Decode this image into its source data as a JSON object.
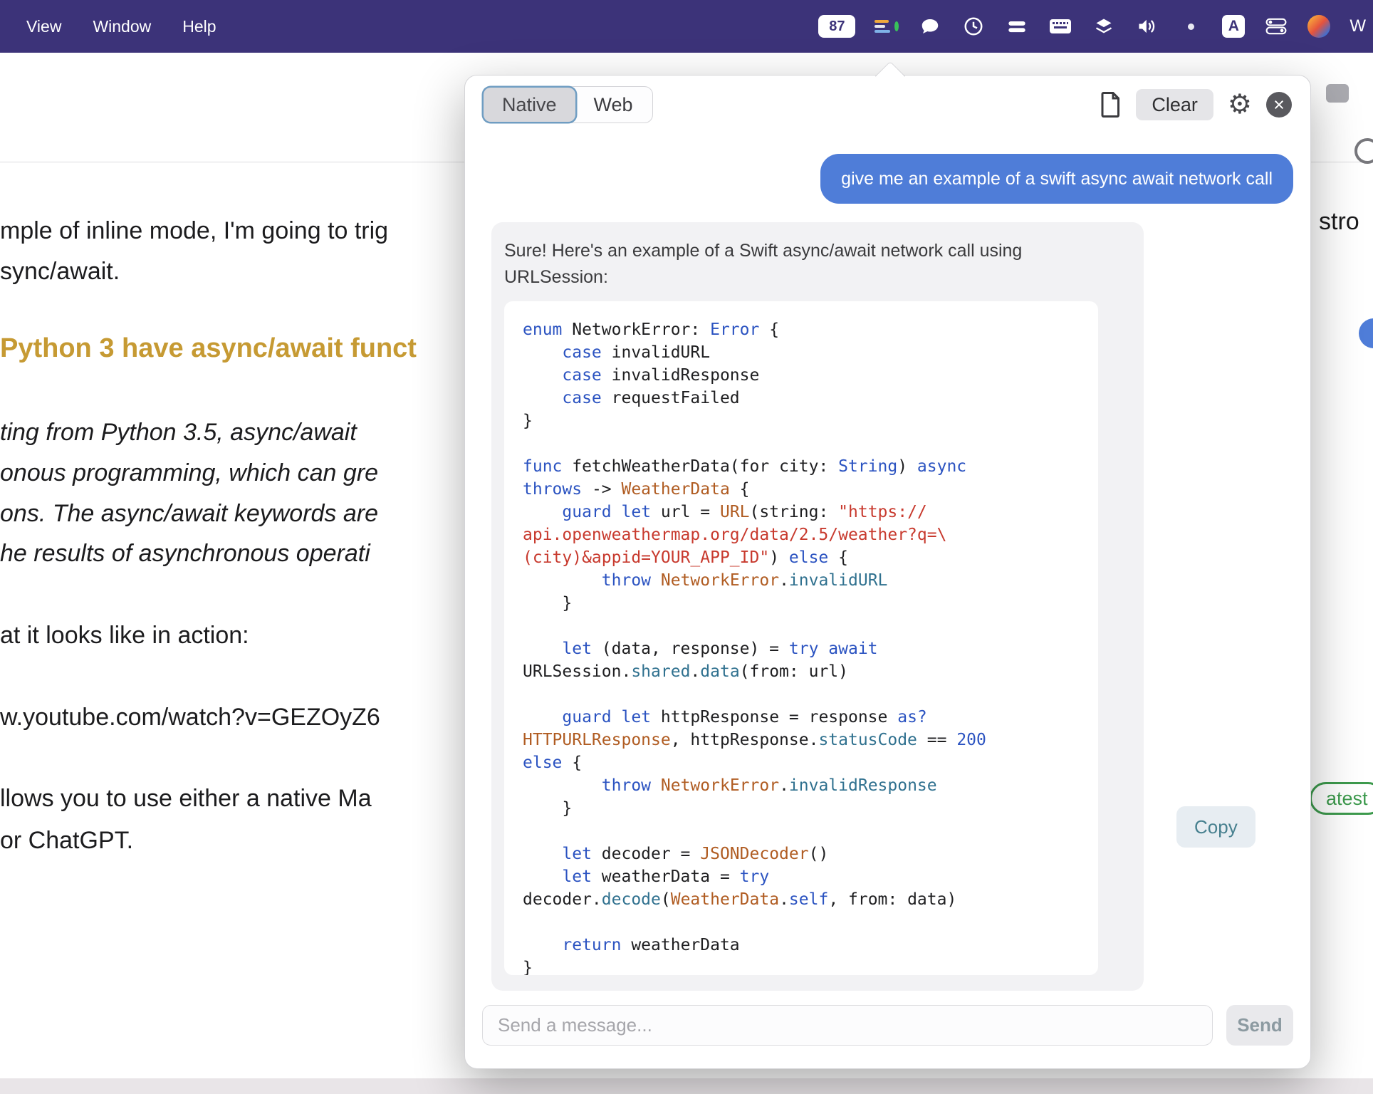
{
  "theme": {
    "menubar_bg": "#3c3379",
    "accent_bubble": "#4f7dd8",
    "heading": "#c69a33",
    "badge_green": "#3d9a4d"
  },
  "menubar": {
    "items": [
      {
        "label": "View"
      },
      {
        "label": "Window"
      },
      {
        "label": "Help"
      }
    ],
    "battery_percent": "87",
    "right_edge_label": "W",
    "icon_names": [
      "istat-bars-icon",
      "chat-bubble-icon",
      "clock-icon",
      "stacked-bars-icon",
      "keyboard-icon",
      "layers-icon",
      "volume-icon",
      "recording-dot-icon",
      "input-source-a-icon",
      "control-center-icon",
      "profile-avatar-icon"
    ]
  },
  "toolbar": {
    "icon_names": [
      "chevron-up-icon",
      "chevron-down-icon",
      "back-icon",
      "plus-icon",
      "microphone-icon",
      "import-tray-icon",
      "trash-icon",
      "clock-icon",
      "person-icon",
      "shield-icon",
      "chevron-up-small-icon",
      "window-icon"
    ]
  },
  "background_page": {
    "para_line_1": "mple of inline mode, I'm going to trig",
    "para_line_2": "sync/await.",
    "heading": "Python 3 have async/await funct",
    "italic_lines": [
      "ting from Python 3.5, async/await",
      "onous programming, which can gre",
      "ons. The async/await keywords are",
      "he results of asynchronous operati"
    ],
    "action_line": "at it looks like in action:",
    "url_line": "w.youtube.com/watch?v=GEZOyZ6",
    "allows_line": "llows you to use either a native Ma",
    "chatgpt_line": "or ChatGPT.",
    "right_fragment": "stro",
    "right_badge": "atest"
  },
  "popup": {
    "tabs": [
      {
        "label": "Native",
        "active": true
      },
      {
        "label": "Web",
        "active": false
      }
    ],
    "clear_label": "Clear",
    "user_message": "give me an example of a swift async await network call",
    "assistant_intro": "Sure! Here's an example of a Swift async/await network call using URLSession:",
    "copy_label": "Copy",
    "composer": {
      "placeholder": "Send a message...",
      "send_label": "Send"
    },
    "code": {
      "language": "swift",
      "colors": {
        "k": "#2b53c1",
        "t": "#b05c22",
        "s": "#c83a2e",
        "m": "#30718f",
        "p": "#1f1f21"
      },
      "lines": [
        [
          [
            "k",
            "enum"
          ],
          [
            "p",
            " NetworkError: "
          ],
          [
            "k",
            "Error"
          ],
          [
            "p",
            " {"
          ]
        ],
        [
          [
            "p",
            "    "
          ],
          [
            "k",
            "case"
          ],
          [
            "p",
            " invalidURL"
          ]
        ],
        [
          [
            "p",
            "    "
          ],
          [
            "k",
            "case"
          ],
          [
            "p",
            " invalidResponse"
          ]
        ],
        [
          [
            "p",
            "    "
          ],
          [
            "k",
            "case"
          ],
          [
            "p",
            " requestFailed"
          ]
        ],
        [
          [
            "p",
            "}"
          ]
        ],
        [],
        [
          [
            "k",
            "func"
          ],
          [
            "p",
            " fetchWeatherData(for city: "
          ],
          [
            "k",
            "String"
          ],
          [
            "p",
            ") "
          ],
          [
            "k",
            "async"
          ]
        ],
        [
          [
            "k",
            "throws"
          ],
          [
            "p",
            " -> "
          ],
          [
            "t",
            "WeatherData"
          ],
          [
            "p",
            " {"
          ]
        ],
        [
          [
            "p",
            "    "
          ],
          [
            "k",
            "guard"
          ],
          [
            "p",
            " "
          ],
          [
            "k",
            "let"
          ],
          [
            "p",
            " url = "
          ],
          [
            "t",
            "URL"
          ],
          [
            "p",
            "(string: "
          ],
          [
            "s",
            "\"https://"
          ]
        ],
        [
          [
            "s",
            "api.openweathermap.org/data/2.5/weather?q=\\"
          ]
        ],
        [
          [
            "s",
            "(city)&appid=YOUR_APP_ID\""
          ],
          [
            "p",
            ") "
          ],
          [
            "k",
            "else"
          ],
          [
            "p",
            " {"
          ]
        ],
        [
          [
            "p",
            "        "
          ],
          [
            "k",
            "throw"
          ],
          [
            "p",
            " "
          ],
          [
            "t",
            "NetworkError"
          ],
          [
            "p",
            "."
          ],
          [
            "m",
            "invalidURL"
          ]
        ],
        [
          [
            "p",
            "    }"
          ]
        ],
        [],
        [
          [
            "p",
            "    "
          ],
          [
            "k",
            "let"
          ],
          [
            "p",
            " (data, response) = "
          ],
          [
            "k",
            "try"
          ],
          [
            "p",
            " "
          ],
          [
            "k",
            "await"
          ]
        ],
        [
          [
            "p",
            "URLSession."
          ],
          [
            "m",
            "shared"
          ],
          [
            "p",
            "."
          ],
          [
            "m",
            "data"
          ],
          [
            "p",
            "(from: url)"
          ]
        ],
        [],
        [
          [
            "p",
            "    "
          ],
          [
            "k",
            "guard"
          ],
          [
            "p",
            " "
          ],
          [
            "k",
            "let"
          ],
          [
            "p",
            " httpResponse = response "
          ],
          [
            "k",
            "as?"
          ]
        ],
        [
          [
            "t",
            "HTTPURLResponse"
          ],
          [
            "p",
            ", httpResponse."
          ],
          [
            "m",
            "statusCode"
          ],
          [
            "p",
            " == "
          ],
          [
            "k",
            "200"
          ]
        ],
        [
          [
            "k",
            "else"
          ],
          [
            "p",
            " {"
          ]
        ],
        [
          [
            "p",
            "        "
          ],
          [
            "k",
            "throw"
          ],
          [
            "p",
            " "
          ],
          [
            "t",
            "NetworkError"
          ],
          [
            "p",
            "."
          ],
          [
            "m",
            "invalidResponse"
          ]
        ],
        [
          [
            "p",
            "    }"
          ]
        ],
        [],
        [
          [
            "p",
            "    "
          ],
          [
            "k",
            "let"
          ],
          [
            "p",
            " decoder = "
          ],
          [
            "t",
            "JSONDecoder"
          ],
          [
            "p",
            "()"
          ]
        ],
        [
          [
            "p",
            "    "
          ],
          [
            "k",
            "let"
          ],
          [
            "p",
            " weatherData = "
          ],
          [
            "k",
            "try"
          ]
        ],
        [
          [
            "p",
            "decoder."
          ],
          [
            "m",
            "decode"
          ],
          [
            "p",
            "("
          ],
          [
            "t",
            "WeatherData"
          ],
          [
            "p",
            "."
          ],
          [
            "k",
            "self"
          ],
          [
            "p",
            ", from: data)"
          ]
        ],
        [],
        [
          [
            "p",
            "    "
          ],
          [
            "k",
            "return"
          ],
          [
            "p",
            " weatherData"
          ]
        ],
        [
          [
            "p",
            "}"
          ]
        ]
      ]
    }
  }
}
